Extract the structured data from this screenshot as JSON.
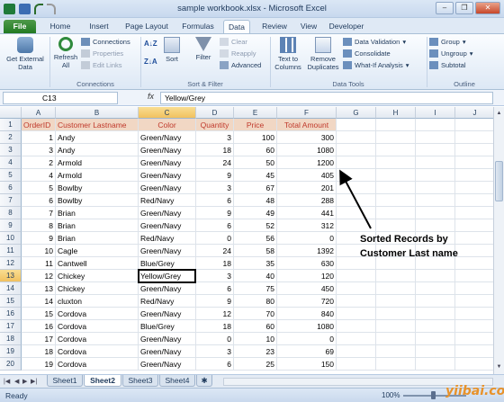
{
  "window": {
    "title": "sample workbook.xlsx - Microsoft Excel"
  },
  "tabs": [
    "File",
    "Home",
    "Insert",
    "Page Layout",
    "Formulas",
    "Data",
    "Review",
    "View",
    "Developer"
  ],
  "ribbon": {
    "get_external_data": "Get External Data",
    "refresh_all": "Refresh All",
    "connections": "Connections",
    "properties": "Properties",
    "edit_links": "Edit Links",
    "group_connections": "Connections",
    "sort": "Sort",
    "filter": "Filter",
    "clear": "Clear",
    "reapply": "Reapply",
    "advanced": "Advanced",
    "group_sort_filter": "Sort & Filter",
    "text_to_columns": "Text to Columns",
    "remove_duplicates": "Remove Duplicates",
    "data_validation": "Data Validation",
    "consolidate": "Consolidate",
    "what_if": "What-If Analysis",
    "group_data_tools": "Data Tools",
    "group": "Group",
    "ungroup": "Ungroup",
    "subtotal": "Subtotal",
    "group_outline": "Outline"
  },
  "formula_bar": {
    "name_box": "C13",
    "fx": "fx",
    "content": "Yellow/Grey"
  },
  "columns": [
    "A",
    "B",
    "C",
    "D",
    "E",
    "F",
    "G",
    "H",
    "I",
    "J"
  ],
  "header_row": [
    "OrderID",
    "Customer Lastname",
    "Color",
    "Quantity",
    "Price",
    "Total Amount"
  ],
  "rows": [
    [
      "1",
      "Andy",
      "Green/Navy",
      "3",
      "100",
      "300"
    ],
    [
      "3",
      "Andy",
      "Green/Navy",
      "18",
      "60",
      "1080"
    ],
    [
      "2",
      "Armold",
      "Green/Navy",
      "24",
      "50",
      "1200"
    ],
    [
      "4",
      "Armold",
      "Green/Navy",
      "9",
      "45",
      "405"
    ],
    [
      "5",
      "Bowlby",
      "Green/Navy",
      "3",
      "67",
      "201"
    ],
    [
      "6",
      "Bowlby",
      "Red/Navy",
      "6",
      "48",
      "288"
    ],
    [
      "7",
      "Brian",
      "Green/Navy",
      "9",
      "49",
      "441"
    ],
    [
      "8",
      "Brian",
      "Green/Navy",
      "6",
      "52",
      "312"
    ],
    [
      "9",
      "Brian",
      "Red/Navy",
      "0",
      "56",
      "0"
    ],
    [
      "10",
      "Cagle",
      "Green/Navy",
      "24",
      "58",
      "1392"
    ],
    [
      "11",
      "Cantwell",
      "Blue/Grey",
      "18",
      "35",
      "630"
    ],
    [
      "12",
      "Chickey",
      "Yellow/Grey",
      "3",
      "40",
      "120"
    ],
    [
      "13",
      "Chickey",
      "Green/Navy",
      "6",
      "75",
      "450"
    ],
    [
      "14",
      "cluxton",
      "Red/Navy",
      "9",
      "80",
      "720"
    ],
    [
      "15",
      "Cordova",
      "Green/Navy",
      "12",
      "70",
      "840"
    ],
    [
      "16",
      "Cordova",
      "Blue/Grey",
      "18",
      "60",
      "1080"
    ],
    [
      "17",
      "Cordova",
      "Green/Navy",
      "0",
      "10",
      "0"
    ],
    [
      "18",
      "Cordova",
      "Green/Navy",
      "3",
      "23",
      "69"
    ],
    [
      "19",
      "Cordova",
      "Green/Navy",
      "6",
      "25",
      "150"
    ]
  ],
  "row_numbers": [
    "1",
    "2",
    "3",
    "4",
    "5",
    "6",
    "7",
    "8",
    "9",
    "10",
    "11",
    "12",
    "13",
    "14",
    "15",
    "16",
    "17",
    "18",
    "19",
    "20"
  ],
  "sheets": [
    "Sheet1",
    "Sheet2",
    "Sheet3",
    "Sheet4"
  ],
  "status": {
    "ready": "Ready",
    "zoom": "100%"
  },
  "annotation": {
    "line1": "Sorted Records by",
    "line2": "Customer Last name"
  },
  "watermark": "yiibai.com",
  "colors": {
    "header_fill": "#f1d7c4",
    "header_text": "#c0392b",
    "file_tab": "#227a23",
    "selected_header": "#f1c15f"
  }
}
